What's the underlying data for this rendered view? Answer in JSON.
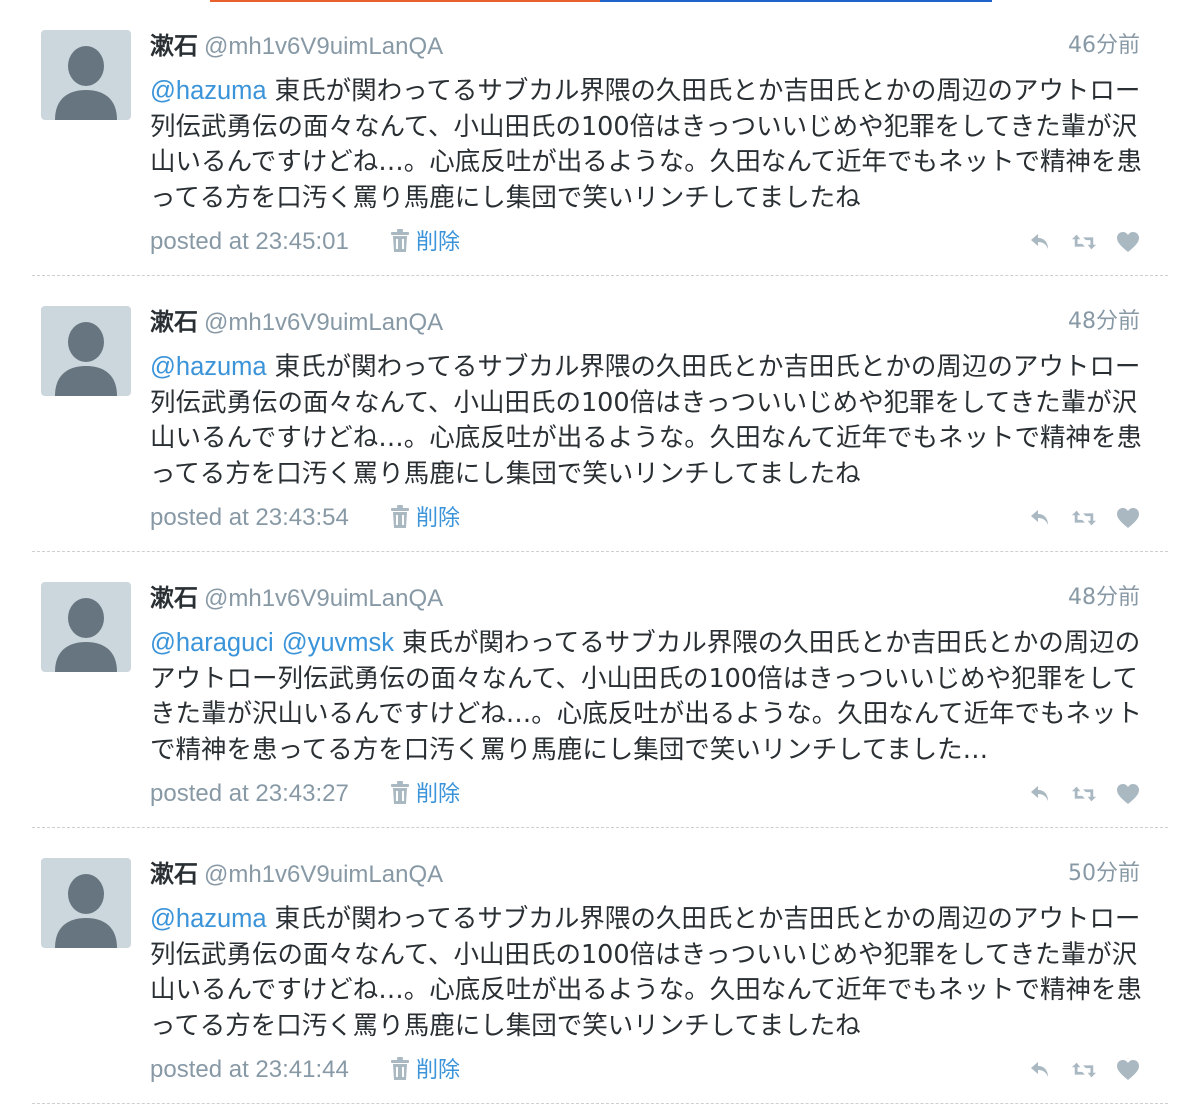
{
  "colors": {
    "accent_orange": "#e8602c",
    "accent_blue": "#1d63c9",
    "link": "#3b94d9",
    "muted": "#8899a6",
    "text": "#292f33",
    "icon": "#aab8c2",
    "avatar_bg": "#ccd6dd",
    "avatar_fg": "#66757f"
  },
  "tweets": [
    {
      "name": "漱石",
      "handle": "@mh1v6V9uimLanQA",
      "time_ago": "46分前",
      "mentions": [
        "@hazuma"
      ],
      "text": "東氏が関わってるサブカル界隈の久田氏とか吉田氏とかの周辺のアウトロー列伝武勇伝の面々なんて、小山田氏の100倍はきっついいじめや犯罪をしてきた輩が沢山いるんですけどね…。心底反吐が出るような。久田なんて近年でもネットで精神を患ってる方を口汚く罵り馬鹿にし集団で笑いリンチしてましたね",
      "posted": "posted at 23:45:01",
      "delete_label": "削除",
      "icons": [
        "trash-icon",
        "reply-icon",
        "retweet-icon",
        "like-icon"
      ]
    },
    {
      "name": "漱石",
      "handle": "@mh1v6V9uimLanQA",
      "time_ago": "48分前",
      "mentions": [
        "@hazuma"
      ],
      "text": "東氏が関わってるサブカル界隈の久田氏とか吉田氏とかの周辺のアウトロー列伝武勇伝の面々なんて、小山田氏の100倍はきっついいじめや犯罪をしてきた輩が沢山いるんですけどね…。心底反吐が出るような。久田なんて近年でもネットで精神を患ってる方を口汚く罵り馬鹿にし集団で笑いリンチしてましたね",
      "posted": "posted at 23:43:54",
      "delete_label": "削除",
      "icons": [
        "trash-icon",
        "reply-icon",
        "retweet-icon",
        "like-icon"
      ]
    },
    {
      "name": "漱石",
      "handle": "@mh1v6V9uimLanQA",
      "time_ago": "48分前",
      "mentions": [
        "@haraguci",
        "@yuvmsk"
      ],
      "text": "東氏が関わってるサブカル界隈の久田氏とか吉田氏とかの周辺のアウトロー列伝武勇伝の面々なんて、小山田氏の100倍はきっついいじめや犯罪をしてきた輩が沢山いるんですけどね…。心底反吐が出るような。久田なんて近年でもネットで精神を患ってる方を口汚く罵り馬鹿にし集団で笑いリンチしてました…",
      "posted": "posted at 23:43:27",
      "delete_label": "削除",
      "icons": [
        "trash-icon",
        "reply-icon",
        "retweet-icon",
        "like-icon"
      ]
    },
    {
      "name": "漱石",
      "handle": "@mh1v6V9uimLanQA",
      "time_ago": "50分前",
      "mentions": [
        "@hazuma"
      ],
      "text": "東氏が関わってるサブカル界隈の久田氏とか吉田氏とかの周辺のアウトロー列伝武勇伝の面々なんて、小山田氏の100倍はきっついいじめや犯罪をしてきた輩が沢山いるんですけどね…。心底反吐が出るような。久田なんて近年でもネットで精神を患ってる方を口汚く罵り馬鹿にし集団で笑いリンチしてましたね",
      "posted": "posted at 23:41:44",
      "delete_label": "削除",
      "icons": [
        "trash-icon",
        "reply-icon",
        "retweet-icon",
        "like-icon"
      ]
    }
  ]
}
